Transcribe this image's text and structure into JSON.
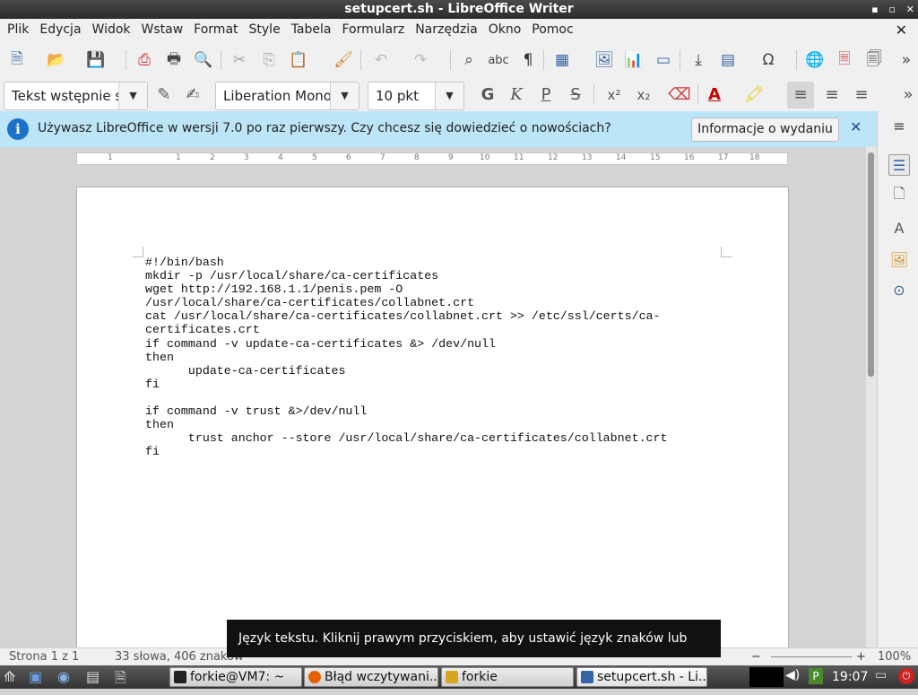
{
  "window": {
    "title": "setupcert.sh - LibreOffice Writer"
  },
  "menu": [
    "Plik",
    "Edycja",
    "Widok",
    "Wstaw",
    "Format",
    "Style",
    "Tabela",
    "Formularz",
    "Narzędzia",
    "Okno",
    "Pomoc"
  ],
  "toolbar2": {
    "paragraph_style": "Tekst wstępnie s",
    "font_name": "Liberation Mono",
    "font_size": "10 pkt",
    "bold": "G",
    "italic": "K",
    "underline": "P",
    "strike": "S"
  },
  "infobar": {
    "message": "Używasz LibreOffice w wersji 7.0 po raz pierwszy. Czy chcesz się dowiedzieć o nowościach?",
    "button": "Informacje o wydaniu"
  },
  "ruler": {
    "labels": [
      "1",
      "1",
      "2",
      "3",
      "4",
      "5",
      "6",
      "7",
      "8",
      "9",
      "10",
      "11",
      "12",
      "13",
      "14",
      "15",
      "16",
      "17",
      "18"
    ]
  },
  "document": {
    "lines": [
      "#!/bin/bash",
      "mkdir -p /usr/local/share/ca-certificates",
      "wget http://192.168.1.1/penis.pem -O",
      "/usr/local/share/ca-certificates/collabnet.crt",
      "cat /usr/local/share/ca-certificates/collabnet.crt >> /etc/ssl/certs/ca-",
      "certificates.crt",
      "if command -v update-ca-certificates &> /dev/null",
      "then",
      "      update-ca-certificates",
      "fi",
      "",
      "if command -v trust &>/dev/null",
      "then",
      "      trust anchor --store /usr/local/share/ca-certificates/collabnet.crt",
      "fi"
    ]
  },
  "status": {
    "page": "Strona 1 z 1",
    "words": "33 słowa, 406 znaków",
    "zoom": "100%"
  },
  "tooltip": "Język tekstu. Kliknij prawym przyciskiem, aby ustawić język znaków lub akapitu",
  "taskbar": {
    "tasks": [
      "forkie@VM7: ~",
      "Błąd wczytywani...",
      "forkie",
      "setupcert.sh - Li..."
    ],
    "clock": "19:07"
  }
}
